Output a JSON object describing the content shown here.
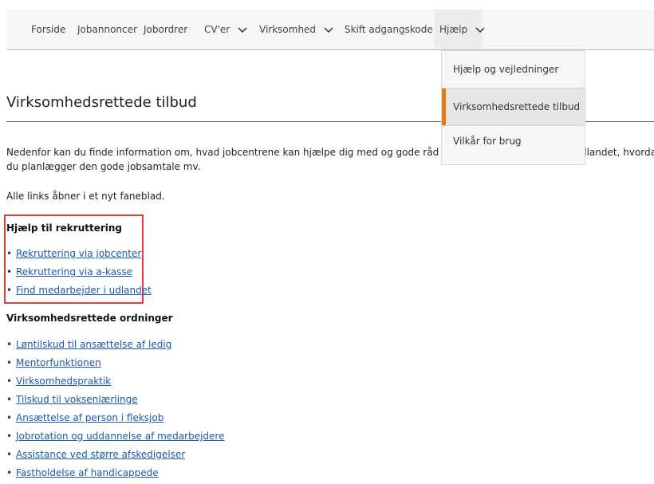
{
  "nav": {
    "items": [
      {
        "label": "Forside"
      },
      {
        "label": "Jobannoncer"
      },
      {
        "label": "Jobordrer"
      },
      {
        "label": "CV'er"
      },
      {
        "label": "Virksomhed"
      },
      {
        "label": "Skift adgangskode"
      },
      {
        "label": "Hjælp"
      }
    ]
  },
  "dropdown": {
    "items": [
      {
        "label": "Hjælp og vejledninger"
      },
      {
        "label": "Virksomhedsrettede tilbud",
        "selected": true
      },
      {
        "label": "Vilkår for brug"
      }
    ]
  },
  "page": {
    "title": "Virksomhedsrettede tilbud",
    "intro_line1_left": "Nedenfor kan du finde information om, hvad jobcentrene kan hjælpe dig med og gode råd omkri",
    "intro_line1_right": "dlandet, hvordan",
    "intro_line2": "du planlægger den gode jobsamtale mv.",
    "links_note": "Alle links åbner i et nyt faneblad."
  },
  "sections": [
    {
      "heading": "Hjælp til rekruttering",
      "links": [
        "Rekruttering via jobcenter",
        "Rekruttering via a-kasse",
        "Find medarbejder i udlandet"
      ]
    },
    {
      "heading": "Virksomhedsrettede ordninger",
      "links": [
        "Løntilskud til ansættelse af ledig",
        "Mentorfunktionen",
        "Virksomhedspraktik",
        "Tilskud til voksenlærlinge",
        "Ansættelse af person i fleksjob",
        "Jobrotation og uddannelse af medarbejdere",
        "Assistance ved større afskedigelser",
        "Fastholdelse af handicappede"
      ]
    }
  ],
  "colors": {
    "accent": "#e07b16",
    "link": "#1e58a8",
    "highlight_border": "#e03c3c"
  }
}
